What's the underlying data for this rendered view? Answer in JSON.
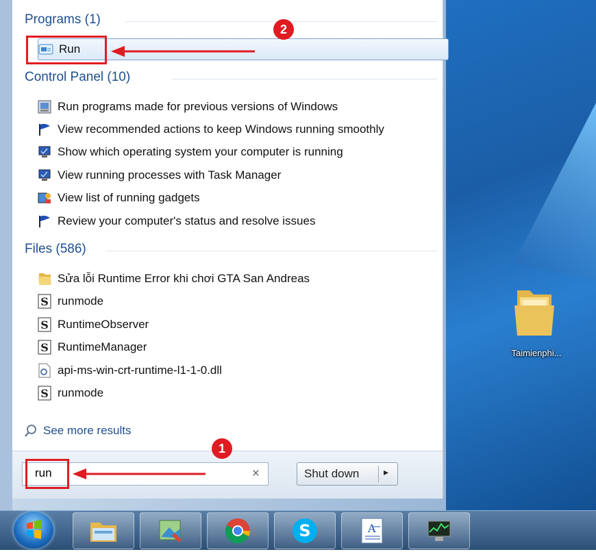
{
  "sections": {
    "programs": "Programs (1)",
    "control_panel": "Control Panel (10)",
    "files": "Files (586)"
  },
  "programs_items": [
    {
      "label": "Run",
      "icon": "run-icon"
    }
  ],
  "control_panel_items": [
    {
      "label": "Run programs made for previous versions of Windows",
      "icon": "compatibility-icon"
    },
    {
      "label": "View recommended actions to keep Windows running smoothly",
      "icon": "flag-icon"
    },
    {
      "label": "Show which operating system your computer is running",
      "icon": "system-icon"
    },
    {
      "label": "View running processes with Task Manager",
      "icon": "system-icon"
    },
    {
      "label": "View list of running gadgets",
      "icon": "gadgets-icon"
    },
    {
      "label": "Review your computer's status and resolve issues",
      "icon": "flag-icon"
    }
  ],
  "files_items": [
    {
      "label": "Sửa lỗi Runtime Error khi chơi GTA San Andreas",
      "icon": "folder-icon"
    },
    {
      "label": "runmode",
      "icon": "script-icon"
    },
    {
      "label": "RuntimeObserver",
      "icon": "script-icon"
    },
    {
      "label": "RuntimeManager",
      "icon": "script-icon"
    },
    {
      "label": "api-ms-win-crt-runtime-l1-1-0.dll",
      "icon": "dll-icon"
    },
    {
      "label": "runmode",
      "icon": "script-icon"
    }
  ],
  "see_more": "See more results",
  "search": {
    "value": "run",
    "clear": "×"
  },
  "shutdown": {
    "label": "Shut down",
    "arrow": "▸"
  },
  "desktop": {
    "folder_label": "Taimienphi..."
  },
  "annotations": {
    "step1": "1",
    "step2": "2"
  },
  "taskbar": [
    "file-explorer-icon",
    "paint-icon",
    "chrome-icon",
    "skype-icon",
    "wordpad-icon",
    "task-manager-icon"
  ],
  "colors": {
    "accent": "#1e4f90",
    "annotation_red": "#e01b22"
  }
}
